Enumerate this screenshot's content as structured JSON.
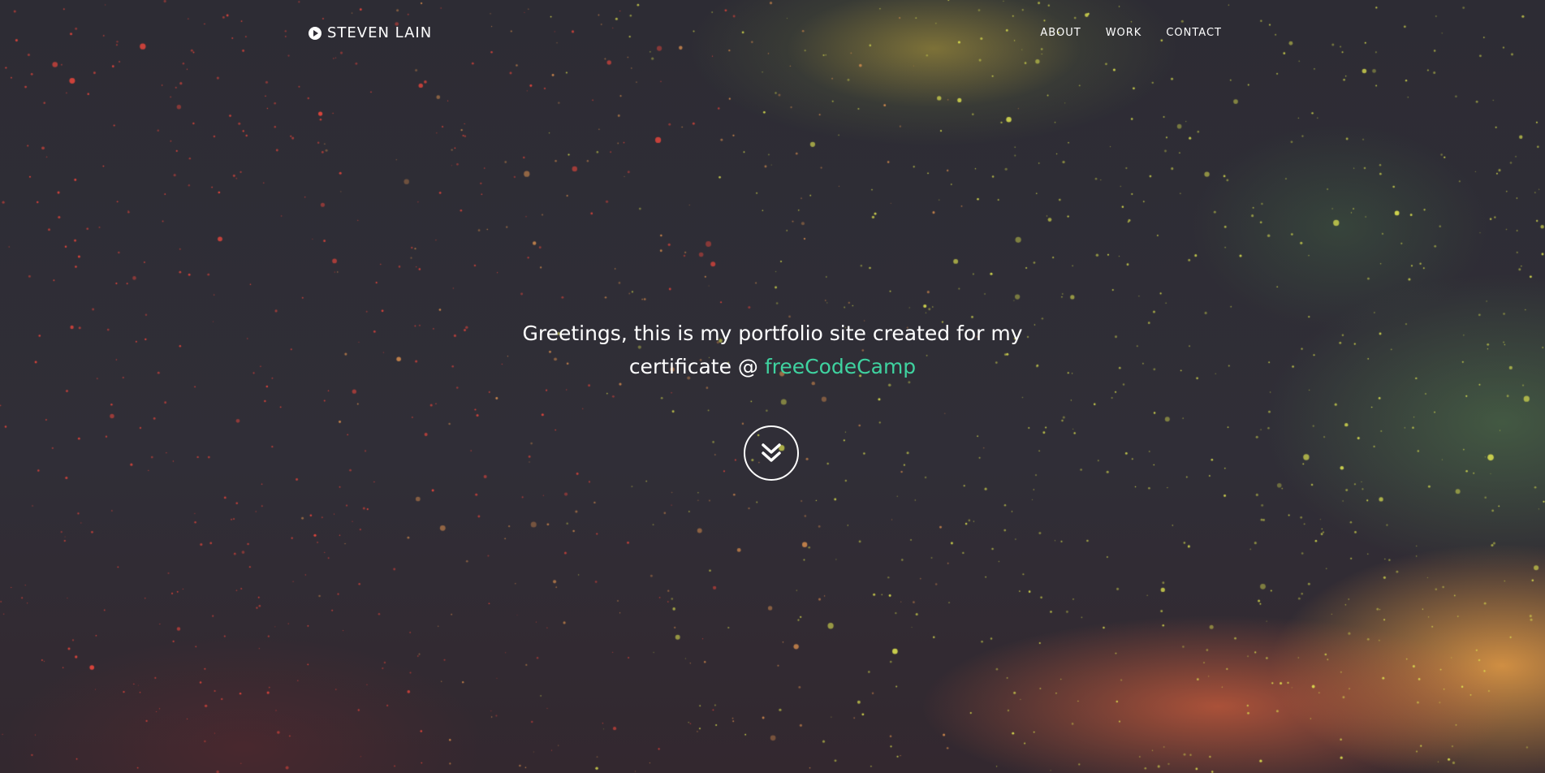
{
  "navbar": {
    "brand_icon": "play-circle-icon",
    "brand": "STEVEN LAIN",
    "links": [
      {
        "label": "ABOUT"
      },
      {
        "label": "WORK"
      },
      {
        "label": "CONTACT"
      }
    ]
  },
  "hero": {
    "intro_line1": "Greetings, this is my portfolio site created for my",
    "intro_line2": "certificate @",
    "link_text": "freeCodeCamp",
    "link_color": "#3fd3a0",
    "scroll_icon": "double-chevron-down-icon"
  },
  "colors": {
    "background": "#2f2d36",
    "text": "#ffffff",
    "accent": "#3fd3a0",
    "star_red": "#e0413a",
    "star_yellow": "#e6e64a",
    "glow_orange": "#eba046"
  }
}
